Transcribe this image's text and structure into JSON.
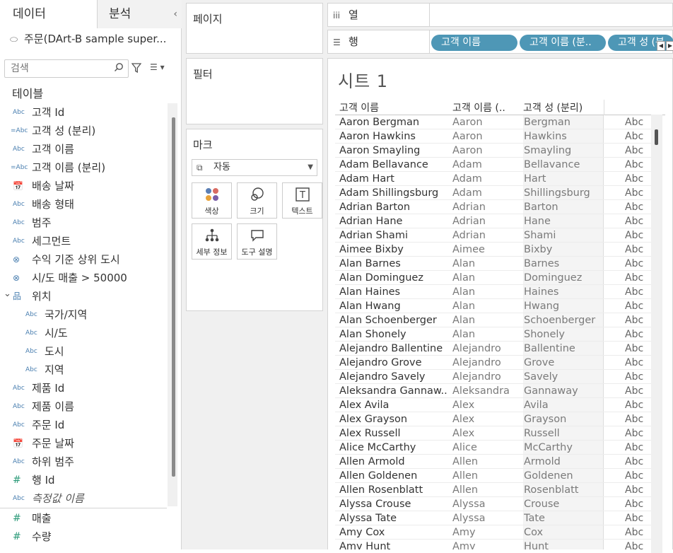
{
  "data_pane": {
    "tab_data": "데이터",
    "tab_analysis": "분석",
    "datasource": "주문(DArt-B sample super...",
    "search_placeholder": "검색",
    "tables_heading": "테이블",
    "fields": [
      {
        "icon": "Abc",
        "label": "고객 Id",
        "type": "dimension"
      },
      {
        "icon": "=Abc",
        "label": "고객 성 (분리)",
        "type": "calculated"
      },
      {
        "icon": "Abc",
        "label": "고객 이름",
        "type": "dimension"
      },
      {
        "icon": "=Abc",
        "label": "고객 이름 (분리)",
        "type": "calculated"
      },
      {
        "icon": "📅",
        "label": "배송 날짜",
        "type": "date"
      },
      {
        "icon": "Abc",
        "label": "배송 형태",
        "type": "dimension"
      },
      {
        "icon": "Abc",
        "label": "범주",
        "type": "dimension"
      },
      {
        "icon": "Abc",
        "label": "세그먼트",
        "type": "dimension"
      },
      {
        "icon": "⊗",
        "label": "수익 기준 상위 도시",
        "type": "set"
      },
      {
        "icon": "⊗",
        "label": "시/도 매출 > 50000",
        "type": "set"
      },
      {
        "icon": "品",
        "label": "위치",
        "type": "hierarchy"
      },
      {
        "icon": "Abc",
        "label": "국가/지역",
        "type": "child"
      },
      {
        "icon": "Abc",
        "label": "시/도",
        "type": "child"
      },
      {
        "icon": "Abc",
        "label": "도시",
        "type": "child"
      },
      {
        "icon": "Abc",
        "label": "지역",
        "type": "child"
      },
      {
        "icon": "Abc",
        "label": "제품 Id",
        "type": "dimension"
      },
      {
        "icon": "Abc",
        "label": "제품 이름",
        "type": "dimension"
      },
      {
        "icon": "Abc",
        "label": "주문 Id",
        "type": "dimension"
      },
      {
        "icon": "📅",
        "label": "주문 날짜",
        "type": "date"
      },
      {
        "icon": "Abc",
        "label": "하위 범주",
        "type": "dimension"
      },
      {
        "icon": "#",
        "label": "행 Id",
        "type": "measure"
      },
      {
        "icon": "Abc",
        "label": "측정값 이름",
        "type": "italic"
      },
      {
        "icon": "#",
        "label": "매출",
        "type": "measure"
      },
      {
        "icon": "#",
        "label": "수량",
        "type": "measure"
      }
    ]
  },
  "shelves": {
    "pages_label": "페이지",
    "filters_label": "필터",
    "marks_label": "마크",
    "mark_type": "자동",
    "mark_buttons": [
      {
        "label": "색상",
        "icon": "color-icon"
      },
      {
        "label": "크기",
        "icon": "size-icon"
      },
      {
        "label": "텍스트",
        "icon": "text-icon"
      },
      {
        "label": "세부 정보",
        "icon": "detail-icon"
      },
      {
        "label": "도구 설명",
        "icon": "tooltip-icon"
      }
    ],
    "columns_label": "열",
    "rows_label": "행",
    "row_pills": [
      "고객 이름",
      "고객 이름 (분..",
      "고객 성 (분"
    ]
  },
  "sheet": {
    "title": "시트 1",
    "headers": [
      "고객 이름",
      "고객 이름 (..",
      "고객 성 (분리)"
    ],
    "placeholder": "Abc",
    "rows": [
      [
        "Aaron Bergman",
        "Aaron",
        "Bergman"
      ],
      [
        "Aaron Hawkins",
        "Aaron",
        "Hawkins"
      ],
      [
        "Aaron Smayling",
        "Aaron",
        "Smayling"
      ],
      [
        "Adam Bellavance",
        "Adam",
        "Bellavance"
      ],
      [
        "Adam Hart",
        "Adam",
        "Hart"
      ],
      [
        "Adam Shillingsburg",
        "Adam",
        "Shillingsburg"
      ],
      [
        "Adrian Barton",
        "Adrian",
        "Barton"
      ],
      [
        "Adrian Hane",
        "Adrian",
        "Hane"
      ],
      [
        "Adrian Shami",
        "Adrian",
        "Shami"
      ],
      [
        "Aimee Bixby",
        "Aimee",
        "Bixby"
      ],
      [
        "Alan Barnes",
        "Alan",
        "Barnes"
      ],
      [
        "Alan Dominguez",
        "Alan",
        "Dominguez"
      ],
      [
        "Alan Haines",
        "Alan",
        "Haines"
      ],
      [
        "Alan Hwang",
        "Alan",
        "Hwang"
      ],
      [
        "Alan Schoenberger",
        "Alan",
        "Schoenberger"
      ],
      [
        "Alan Shonely",
        "Alan",
        "Shonely"
      ],
      [
        "Alejandro Ballentine",
        "Alejandro",
        "Ballentine"
      ],
      [
        "Alejandro Grove",
        "Alejandro",
        "Grove"
      ],
      [
        "Alejandro Savely",
        "Alejandro",
        "Savely"
      ],
      [
        "Aleksandra Gannaw..",
        "Aleksandra",
        "Gannaway"
      ],
      [
        "Alex Avila",
        "Alex",
        "Avila"
      ],
      [
        "Alex Grayson",
        "Alex",
        "Grayson"
      ],
      [
        "Alex Russell",
        "Alex",
        "Russell"
      ],
      [
        "Alice McCarthy",
        "Alice",
        "McCarthy"
      ],
      [
        "Allen Armold",
        "Allen",
        "Armold"
      ],
      [
        "Allen Goldenen",
        "Allen",
        "Goldenen"
      ],
      [
        "Allen Rosenblatt",
        "Allen",
        "Rosenblatt"
      ],
      [
        "Alyssa Crouse",
        "Alyssa",
        "Crouse"
      ],
      [
        "Alyssa Tate",
        "Alyssa",
        "Tate"
      ],
      [
        "Amy Cox",
        "Amy",
        "Cox"
      ],
      [
        "Amy Hunt",
        "Amy",
        "Hunt"
      ]
    ]
  }
}
